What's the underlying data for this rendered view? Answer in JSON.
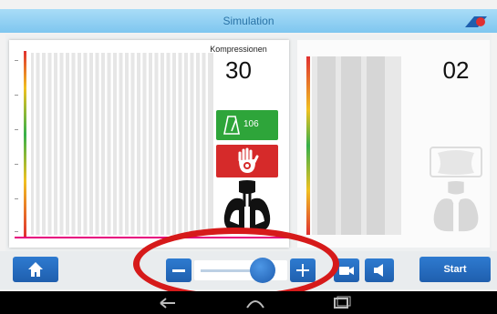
{
  "header": {
    "title": "Simulation"
  },
  "left_panel": {
    "compression_label": "Kompressionen",
    "compression_value": "30",
    "metronome_rate": "106"
  },
  "right_panel": {
    "count_value": "02"
  },
  "toolbar": {
    "start_label": "Start",
    "slider_level_fraction": 0.85
  },
  "colors": {
    "title_bar": "#7ec6ef",
    "button_blue": "#1f5fae",
    "metronome_green": "#2ea53a",
    "alert_red": "#d62a2a",
    "highlight_ring": "#d61a1a",
    "baseline_pink": "#e6007e"
  },
  "icons": {
    "home": "home-icon",
    "metronome": "metronome-icon",
    "hand": "hand-icon",
    "lungs": "lungs-icon",
    "minus": "minus-icon",
    "plus": "plus-icon",
    "camera": "camera-icon",
    "volume": "volume-icon"
  }
}
